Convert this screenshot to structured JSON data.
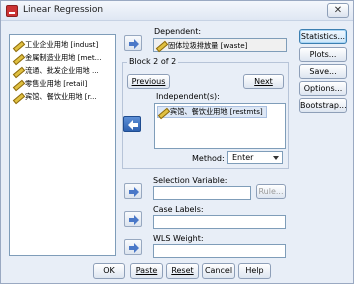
{
  "window": {
    "title": "Linear Regression",
    "close_label": "✕"
  },
  "variables": [
    "工业企业用地 [indust]",
    "金属制造业用地 [met...",
    "流通、批发企业用地 ...",
    "零售业用地 [retail]",
    "宾馆、餐饮业用地 [r..."
  ],
  "dependent": {
    "label": "Dependent:",
    "value": "固体垃圾排放量 [waste]"
  },
  "block": {
    "title": "Block 2 of 2",
    "previous_label": "Previous",
    "next_label": "Next"
  },
  "independent": {
    "label": "Independent(s):",
    "items": [
      "宾馆、餐饮业用地 [restmts]"
    ]
  },
  "method": {
    "label": "Method:",
    "value": "Enter"
  },
  "selection": {
    "label": "Selection Variable:",
    "rule_label": "Rule..."
  },
  "case_labels": {
    "label": "Case Labels:"
  },
  "wls": {
    "label": "WLS Weight:"
  },
  "side_buttons": {
    "statistics": "Statistics...",
    "plots": "Plots...",
    "save": "Save...",
    "options": "Options...",
    "bootstrap": "Bootstrap..."
  },
  "bottom_buttons": {
    "ok": "OK",
    "paste": "Paste",
    "reset": "Reset",
    "cancel": "Cancel",
    "help": "Help"
  }
}
